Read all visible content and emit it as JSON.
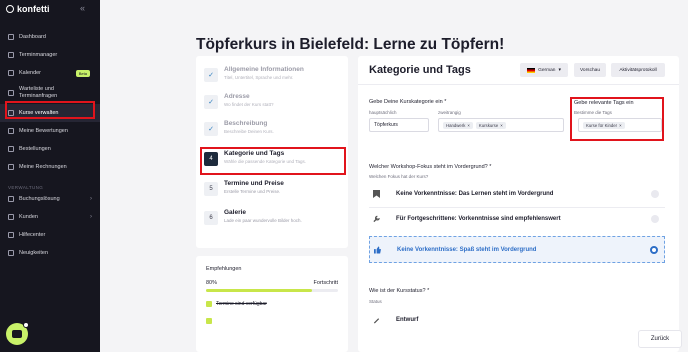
{
  "app": {
    "logo": "konfetti"
  },
  "sidebar": {
    "items": [
      {
        "label": "Dashboard"
      },
      {
        "label": "Terminmanager"
      },
      {
        "label": "Kalender",
        "badge": "Beta"
      },
      {
        "label": "Warteliste und Terminanfragen"
      },
      {
        "label": "Kurse verwalten"
      },
      {
        "label": "Meine Bewertungen"
      },
      {
        "label": "Bestellungen"
      },
      {
        "label": "Meine Rechnungen"
      }
    ],
    "section": "VERWALTUNG",
    "items2": [
      {
        "label": "Buchungslösung"
      },
      {
        "label": "Kunden"
      },
      {
        "label": "Hilfecenter"
      },
      {
        "label": "Neuigkeiten"
      }
    ]
  },
  "page": {
    "title": "Töpferkurs in Bielefeld: Lerne zu Töpfern!"
  },
  "steps": [
    {
      "num": "✓",
      "title": "Allgemeine Informationen",
      "sub": "Titel, Untertitel, Sprache und mehr."
    },
    {
      "num": "✓",
      "title": "Adresse",
      "sub": "Wo findet der Kurs statt?"
    },
    {
      "num": "✓",
      "title": "Beschreibung",
      "sub": "Beschreibe Deinen Kurs."
    },
    {
      "num": "4",
      "title": "Kategorie und Tags",
      "sub": "Wähle die passende Kategorie und Tags."
    },
    {
      "num": "5",
      "title": "Termine und Preise",
      "sub": "Erstelle Termine und Preise."
    },
    {
      "num": "6",
      "title": "Galerie",
      "sub": "Lade ein paar wundervolle Bilder hoch."
    }
  ],
  "reco": {
    "title": "Empfehlungen",
    "percent": "80%",
    "progress_label": "Fortschritt",
    "progress": 0.8,
    "checks": [
      "Termine sind verfügbar"
    ]
  },
  "panel": {
    "title": "Kategorie und Tags",
    "lang": "German",
    "preview": "Vorschau",
    "log": "Aktivitätsprotokoll",
    "category": {
      "label": "Gebe Deine Kurskategorie ein *",
      "main_label": "hauptsächlich",
      "main_value": "Töpferkurs",
      "second_label": "zweitrangig",
      "chips": [
        "Handwerk",
        "Kurskurse"
      ]
    },
    "tags": {
      "label": "Gebe relevante Tags ein",
      "sub": "Bestimme die Tags",
      "chips": [
        "Kurse für Kinder"
      ]
    },
    "focus": {
      "label": "Welcher Workshop-Fokus steht im Vordergrund? *",
      "sub": "Welchen Fokus hat der Kurs?",
      "options": [
        {
          "icon": "bookmark-icon",
          "text": "Keine Vorkenntnisse: Das Lernen steht im Vordergrund"
        },
        {
          "icon": "wrench-icon",
          "text": "Für Fortgeschrittene: Vorkenntnisse sind empfehlenswert"
        },
        {
          "icon": "thumbs-up-icon",
          "text": "Keine Vorkenntnisse: Spaß steht im Vordergrund"
        }
      ]
    },
    "status": {
      "label": "Wie ist der Kursstatus? *",
      "sub": "Status",
      "value": "Entwurf"
    }
  },
  "footer": {
    "back": "Zurück"
  },
  "colors": {
    "accent": "#c8f169",
    "highlight": "#e1141c",
    "primary": "#2d6ec7"
  }
}
